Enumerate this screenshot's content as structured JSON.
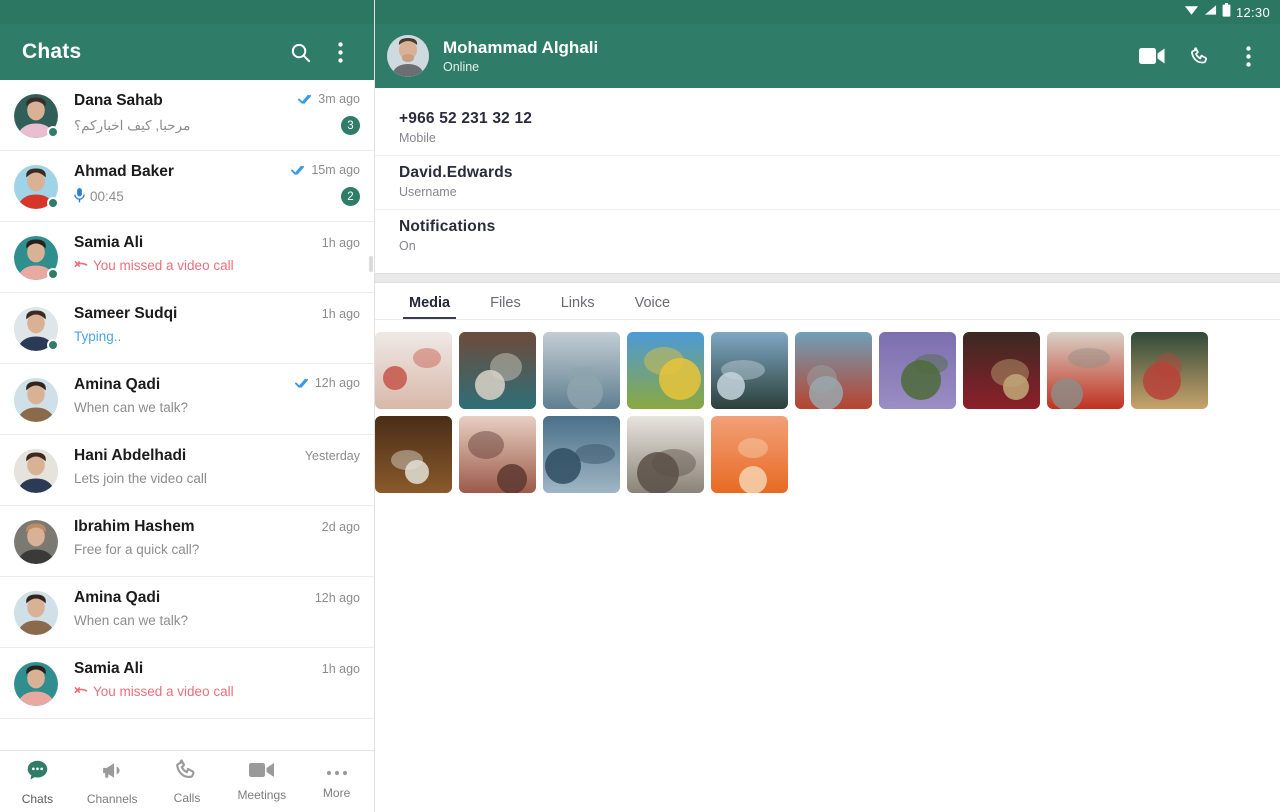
{
  "status_bar": {
    "time": "12:30",
    "icons": [
      "wifi-icon",
      "signal-icon",
      "battery-icon"
    ]
  },
  "sidebar": {
    "title": "Chats",
    "search_icon": "search-icon",
    "overflow_icon": "overflow-menu-icon",
    "fab_label": "+",
    "chats": [
      {
        "name": "Dana Sahab",
        "preview": "مرحبا, كيف اخباركم؟",
        "time": "3m ago",
        "badge": "3",
        "ticks": true,
        "online": true,
        "rtl": true,
        "state": "normal"
      },
      {
        "name": "Ahmad Baker",
        "preview": "00:45",
        "time": "15m ago",
        "badge": "2",
        "ticks": true,
        "online": true,
        "rtl": false,
        "state": "voice"
      },
      {
        "name": "Samia Ali",
        "preview": "You missed a video call",
        "time": "1h ago",
        "badge": "",
        "ticks": false,
        "online": true,
        "rtl": false,
        "state": "missed"
      },
      {
        "name": "Sameer Sudqi",
        "preview": "Typing..",
        "time": "1h ago",
        "badge": "",
        "ticks": false,
        "online": true,
        "rtl": false,
        "state": "typing"
      },
      {
        "name": "Amina Qadi",
        "preview": "When can we talk?",
        "time": "12h ago",
        "badge": "",
        "ticks": true,
        "online": false,
        "rtl": false,
        "state": "normal"
      },
      {
        "name": "Hani Abdelhadi",
        "preview": "Lets join the video call",
        "time": "Yesterday",
        "badge": "",
        "ticks": false,
        "online": false,
        "rtl": false,
        "state": "normal"
      },
      {
        "name": "Ibrahim Hashem",
        "preview": "Free for a quick call?",
        "time": "2d ago",
        "badge": "",
        "ticks": false,
        "online": false,
        "rtl": false,
        "state": "normal"
      },
      {
        "name": "Amina Qadi",
        "preview": "When can we talk?",
        "time": "12h ago",
        "badge": "",
        "ticks": false,
        "online": false,
        "rtl": false,
        "state": "normal"
      },
      {
        "name": "Samia Ali",
        "preview": "You missed a video call",
        "time": "1h ago",
        "badge": "",
        "ticks": false,
        "online": false,
        "rtl": false,
        "state": "missed"
      }
    ]
  },
  "bottom_nav": {
    "items": [
      {
        "label": "Chats",
        "icon": "chats-icon",
        "active": true
      },
      {
        "label": "Channels",
        "icon": "megaphone-icon",
        "active": false
      },
      {
        "label": "Calls",
        "icon": "phone-icon",
        "active": false
      },
      {
        "label": "Meetings",
        "icon": "video-camera-icon",
        "active": false
      },
      {
        "label": "More",
        "icon": "more-dots-icon",
        "active": false
      }
    ]
  },
  "contact_header": {
    "name": "Mohammad Alghali",
    "status": "Online",
    "avatar": "contact-avatar",
    "actions": [
      {
        "name": "video-call-button",
        "icon": "video-camera-icon"
      },
      {
        "name": "voice-call-button",
        "icon": "phone-icon"
      },
      {
        "name": "overflow-menu-button",
        "icon": "overflow-menu-icon"
      }
    ]
  },
  "contact_info": [
    {
      "value": "+966 52 231 32 12",
      "label": "Mobile"
    },
    {
      "value": "David.Edwards",
      "label": "Username"
    },
    {
      "value": "Notifications",
      "label": "On"
    }
  ],
  "media_tabs": [
    {
      "label": "Media",
      "active": true
    },
    {
      "label": "Files",
      "active": false
    },
    {
      "label": "Links",
      "active": false
    },
    {
      "label": "Voice",
      "active": false
    }
  ],
  "media_items": [
    {
      "alt": "child-sitting-on-carpet",
      "c1": "#efe9e6",
      "c2": "#d8b8a8",
      "c3": "#c6564a"
    },
    {
      "alt": "street-market-boat",
      "c1": "#6d4b3a",
      "c2": "#2f6f78",
      "c3": "#d9d3c8"
    },
    {
      "alt": "coastline-ocean-cliff",
      "c1": "#c3cdd4",
      "c2": "#5f7f90",
      "c3": "#8ea3ae"
    },
    {
      "alt": "yellow-flower-blue-sky",
      "c1": "#4d9ad8",
      "c2": "#8aa83f",
      "c3": "#e8c43a"
    },
    {
      "alt": "palm-trees-sky",
      "c1": "#7fa8c4",
      "c2": "#2c3f3a",
      "c3": "#c5d5dd"
    },
    {
      "alt": "woman-red-dress-balcony",
      "c1": "#6fa0b8",
      "c2": "#b8432f",
      "c3": "#9aa8ae"
    },
    {
      "alt": "lavender-field-hands",
      "c1": "#7b6fae",
      "c2": "#9b8ec4",
      "c3": "#4e6b3a"
    },
    {
      "alt": "red-cherries-bowl",
      "c1": "#3a2a22",
      "c2": "#8d1f2a",
      "c3": "#c2a878"
    },
    {
      "alt": "red-door-archway",
      "c1": "#d8d2c8",
      "c2": "#c0311f",
      "c3": "#8e8c86"
    },
    {
      "alt": "wooden-boat-green-water",
      "c1": "#2f4a3a",
      "c2": "#c9a36a",
      "c3": "#b7423a"
    },
    {
      "alt": "meat-dish-skillet",
      "c1": "#4a2d18",
      "c2": "#8a5a2b",
      "c3": "#e3e0d6"
    },
    {
      "alt": "red-rock-mountain",
      "c1": "#e8cfc2",
      "c2": "#9c5a4a",
      "c3": "#5e3830"
    },
    {
      "alt": "blue-water-bubbles",
      "c1": "#4a7089",
      "c2": "#9fb6c4",
      "c3": "#2f4e62"
    },
    {
      "alt": "fluffy-cat",
      "c1": "#e8e4de",
      "c2": "#8a8378",
      "c3": "#5a5048"
    },
    {
      "alt": "orange-jellyfish",
      "c1": "#f2a07a",
      "c2": "#e86a22",
      "c3": "#f6d3b0"
    }
  ]
}
